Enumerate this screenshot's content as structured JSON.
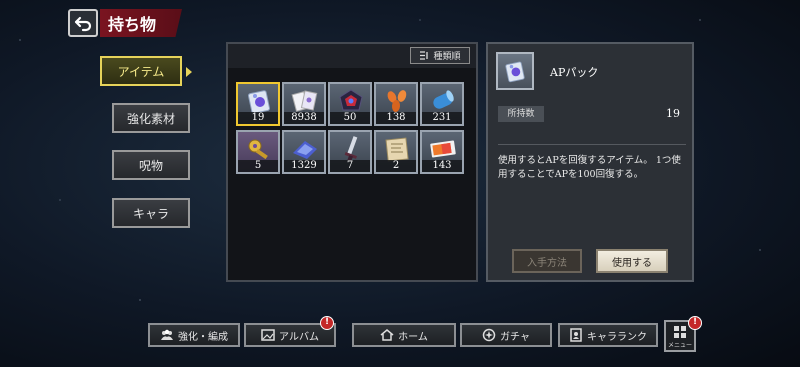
{
  "header": {
    "title": "持ち物"
  },
  "tabs": [
    {
      "label": "アイテム",
      "active": true
    },
    {
      "label": "強化素材",
      "active": false
    },
    {
      "label": "呪物",
      "active": false
    },
    {
      "label": "キャラ",
      "active": false
    }
  ],
  "sort": {
    "label": "種類順"
  },
  "items": [
    {
      "icon": "ap-pack-icon",
      "count": "19",
      "selected": true
    },
    {
      "icon": "cards-icon",
      "count": "8938"
    },
    {
      "icon": "red-gem-icon",
      "count": "50"
    },
    {
      "icon": "petals-icon",
      "count": "138"
    },
    {
      "icon": "blue-roll-icon",
      "count": "231"
    },
    {
      "icon": "gold-key-icon",
      "count": "5"
    },
    {
      "icon": "blue-cloth-icon",
      "count": "1329"
    },
    {
      "icon": "sword-icon",
      "count": "7"
    },
    {
      "icon": "map-icon",
      "count": "2"
    },
    {
      "icon": "ticket-icon",
      "count": "143"
    }
  ],
  "detail": {
    "name": "APパック",
    "owned_label": "所持数",
    "owned_value": "19",
    "description": "使用するとAPを回復するアイテム。 1つ使用することでAPを100回復する。",
    "how_button": "入手方法",
    "use_button": "使用する"
  },
  "nav": [
    {
      "label": "強化・編成",
      "icon": "party-icon",
      "badge": false
    },
    {
      "label": "アルバム",
      "icon": "album-icon",
      "badge": true
    },
    {
      "label": "ホーム",
      "icon": "home-icon",
      "badge": false
    },
    {
      "label": "ガチャ",
      "icon": "gacha-icon",
      "badge": false
    },
    {
      "label": "キャラランク",
      "icon": "rank-icon",
      "badge": false
    }
  ],
  "menu": {
    "label": "メニュー",
    "badge": true,
    "badge_text": "!"
  },
  "colors": {
    "title_banner": "#7a1420",
    "selected_border": "#f0c830",
    "badge": "#c42828"
  }
}
